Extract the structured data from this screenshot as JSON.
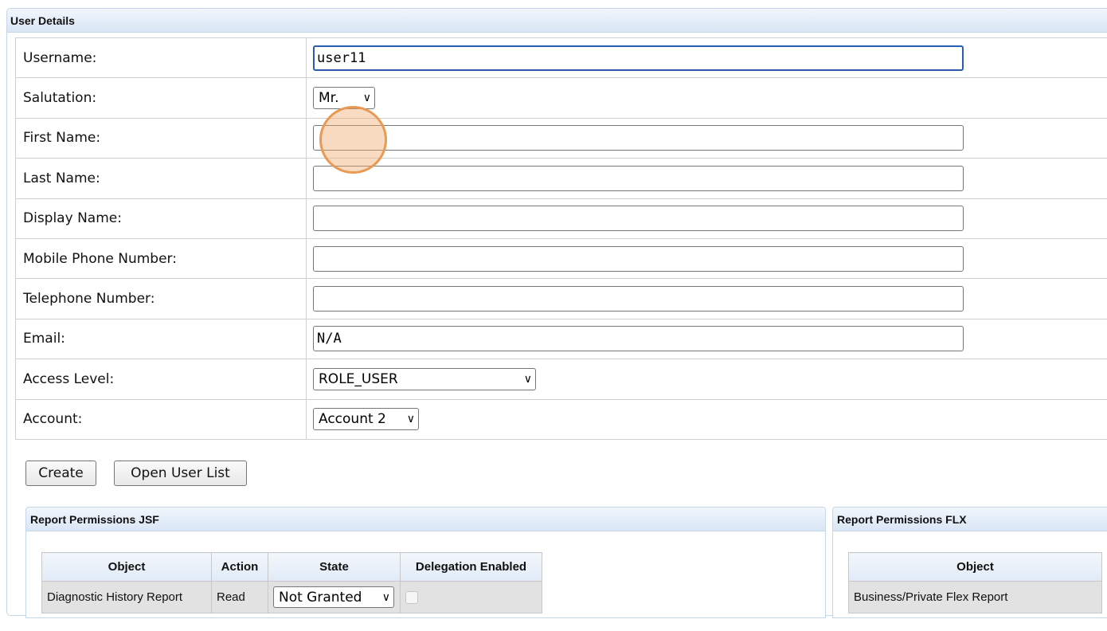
{
  "panel": {
    "title": "User Details"
  },
  "form": {
    "rows": [
      {
        "label": "Username:",
        "value": "user11"
      },
      {
        "label": "Salutation:",
        "value": "Mr."
      },
      {
        "label": "First Name:",
        "value": ""
      },
      {
        "label": "Last Name:",
        "value": ""
      },
      {
        "label": "Display Name:",
        "value": ""
      },
      {
        "label": "Mobile Phone Number:",
        "value": ""
      },
      {
        "label": "Telephone Number:",
        "value": ""
      },
      {
        "label": "Email:",
        "value": "N/A"
      },
      {
        "label": "Access Level:",
        "value": "ROLE_USER"
      },
      {
        "label": "Account:",
        "value": "Account 2"
      }
    ]
  },
  "buttons": {
    "create": "Create",
    "open_user_list": "Open User List"
  },
  "jsf": {
    "title": "Report Permissions JSF",
    "columns": [
      "Object",
      "Action",
      "State",
      "Delegation Enabled"
    ],
    "rows": [
      {
        "object": "Diagnostic History Report",
        "action": "Read",
        "state": "Not Granted",
        "delegation_enabled": false
      }
    ]
  },
  "flx": {
    "title": "Report Permissions FLX",
    "columns": [
      "Object"
    ],
    "rows": [
      {
        "object": "Business/Private Flex Report"
      }
    ]
  },
  "icons": {
    "chevron": "chevron-down-icon",
    "click_marker": "click-indicator"
  },
  "colors": {
    "header_gradient_top": "#f1f6fc",
    "header_gradient_bottom": "#d9e6f5",
    "focus": "#2a5db0",
    "click_marker": "#e89a55"
  }
}
